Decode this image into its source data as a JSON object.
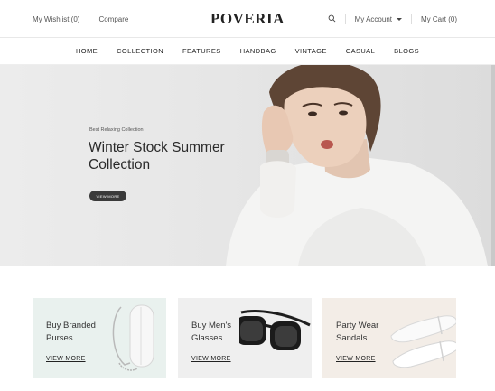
{
  "topbar": {
    "wishlist": "My Wishlist (0)",
    "compare": "Compare",
    "logo": "POVERIA",
    "account": "My Account",
    "cart": "My Cart (0)"
  },
  "nav": [
    "HOME",
    "COLLECTION",
    "FEATURES",
    "HANDBAG",
    "VINTAGE",
    "CASUAL",
    "BLOGS"
  ],
  "hero": {
    "eyebrow": "Best Relaxing Collection",
    "title": "Winter Stock Summer Collection",
    "button": "VIEW MORE"
  },
  "cards": [
    {
      "title": "Buy Branded Purses",
      "link": "VIEW MORE"
    },
    {
      "title": "Buy Men's Glasses",
      "link": "VIEW MORE"
    },
    {
      "title": "Party Wear Sandals",
      "link": "VIEW MORE"
    }
  ],
  "colors": {
    "dark": "#3a3a3a",
    "card1": "#e9f1ee",
    "card2": "#efefef",
    "card3": "#f3ede7"
  }
}
